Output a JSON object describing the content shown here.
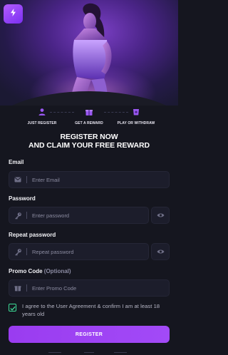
{
  "hero": {
    "logo_icon": "lightning-bolt-icon",
    "accent": "#a24af7"
  },
  "steps": [
    {
      "label": "JUST REGISTER",
      "icon": "user-icon",
      "color": "#8e4ee8"
    },
    {
      "label": "GET A REWARD",
      "icon": "gift-icon",
      "color": "#8e4ee8"
    },
    {
      "label": "PLAY OR WITHDRAW",
      "icon": "wallet-icon",
      "color": "#8e4ee8"
    }
  ],
  "headline": {
    "line1": "REGISTER NOW",
    "line2": "AND CLAIM YOUR FREE REWARD"
  },
  "form": {
    "email": {
      "label": "Email",
      "placeholder": "Enter Email",
      "value": "",
      "icon": "envelope-icon"
    },
    "password": {
      "label": "Password",
      "placeholder": "Enter password",
      "value": "",
      "icon": "key-icon"
    },
    "repeat_password": {
      "label": "Repeat password",
      "placeholder": "Repeat password",
      "value": "",
      "icon": "key-icon"
    },
    "promo": {
      "label": "Promo Code",
      "optional": "(Optional)",
      "placeholder": "Enter Promo Code",
      "value": "",
      "icon": "gift-icon"
    },
    "agreement": {
      "text": "I agree to the User Agreement & confirm I am at least 18 years old",
      "checked": true,
      "check_color": "#3ddc97"
    },
    "submit_label": "REGISTER"
  }
}
